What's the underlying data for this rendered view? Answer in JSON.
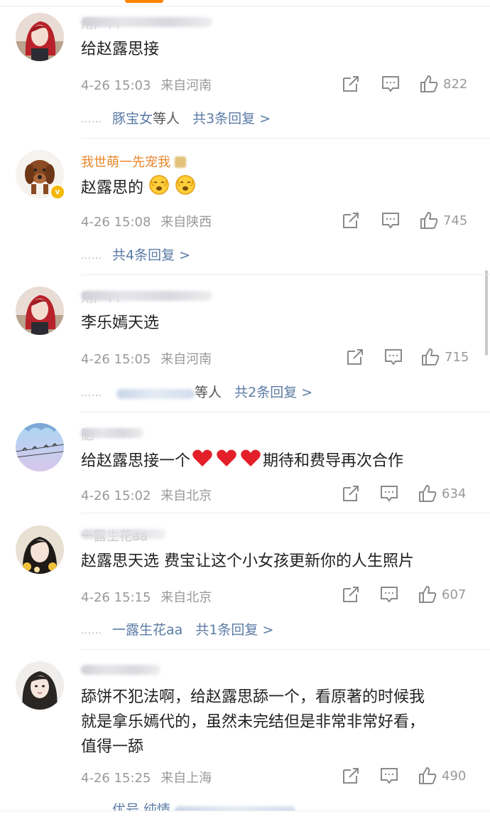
{
  "comments": [
    {
      "username": "用户77",
      "text": "给赵露思接",
      "date": "4-26 15:03",
      "location": "来自河南",
      "likes": "822",
      "reply_names": "豚宝女",
      "reply_suffix": "等人",
      "reply_count": "共3条回复 >",
      "avatar": "red-hair-girl"
    },
    {
      "username": "我世萌一先宠我",
      "text": "赵露思的",
      "date": "4-26 15:08",
      "location": "来自陕西",
      "likes": "745",
      "reply_count": "共4条回复 >",
      "avatar": "dog",
      "verified": true
    },
    {
      "username": "用户77",
      "text": "李乐嫣天选",
      "date": "4-26 15:05",
      "location": "来自河南",
      "likes": "715",
      "reply_suffix": "等人",
      "reply_count": "共2条回复 >",
      "avatar": "red-hair-girl"
    },
    {
      "username": "肥",
      "text_before": "给赵露思接一个",
      "text_after": "期待和费导再次合作",
      "date": "4-26 15:02",
      "location": "来自北京",
      "likes": "634",
      "avatar": "blue-sky-birds"
    },
    {
      "username": "一露生花aa",
      "text": "赵露思天选 费宝让这个小女孩更新你的人生照片",
      "date": "4-26 15:15",
      "location": "来自北京",
      "likes": "607",
      "reply_names": "一露生花aa",
      "reply_count": "共1条回复 >",
      "avatar": "girl-with-flowers"
    },
    {
      "username": "",
      "text_line1": "舔饼不犯法啊，给赵露思舔一个，看原著的时候我",
      "text_line2": "就是拿乐嫣代的，虽然未完结但是非常非常好看，",
      "text_line3": "值得一舔",
      "date": "4-26 15:25",
      "location": "来自上海",
      "likes": "490",
      "reply_names": "优号 纯情",
      "avatar": "dark-hair-girl"
    }
  ],
  "icons": {
    "share": "share-icon",
    "comment": "comment-icon",
    "like": "thumbs-up-icon"
  },
  "colors": {
    "link": "#5b7ba5",
    "meta": "#999999",
    "accent": "#ff8200",
    "gold_name": "#e8862a"
  }
}
